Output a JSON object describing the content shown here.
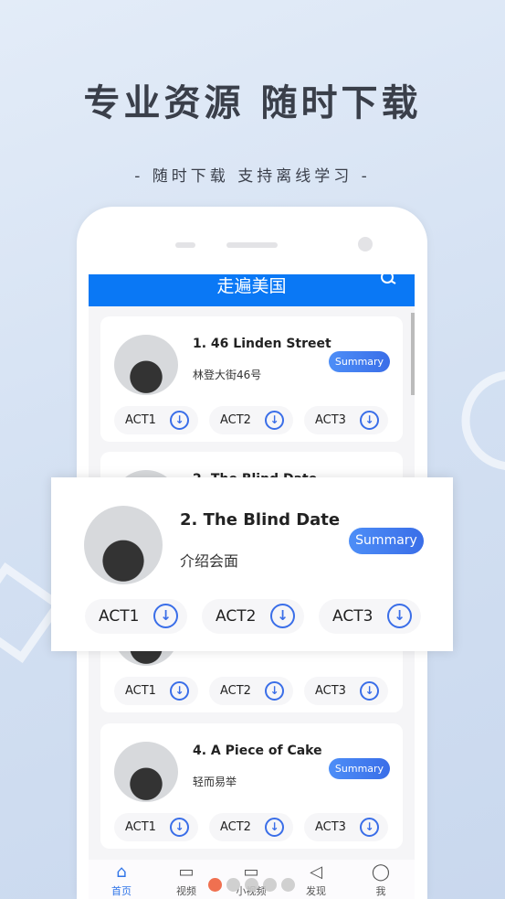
{
  "promo": {
    "headline": "专业资源 随时下载",
    "subline": "- 随时下载 支持离线学习 -"
  },
  "app": {
    "title": "走遍美国",
    "search_icon": "search-icon"
  },
  "colors": {
    "topbar": "#0a78f5",
    "accent": "#3a6ee8",
    "pager_active": "#f07050"
  },
  "cards": [
    {
      "title": "1. 46 Linden Street",
      "subtitle": "林登大街46号",
      "summary": "Summary",
      "acts": [
        "ACT1",
        "ACT2",
        "ACT3"
      ]
    },
    {
      "title": "2. The Blind Date",
      "subtitle": "介绍会面",
      "summary": "Summary",
      "acts": [
        "ACT1",
        "ACT2",
        "ACT3"
      ]
    },
    {
      "title": "",
      "subtitle": "",
      "summary": "",
      "acts": [
        "ACT1",
        "ACT2",
        "ACT3"
      ]
    },
    {
      "title": "4. A Piece of Cake",
      "subtitle": "轻而易举",
      "summary": "Summary",
      "acts": [
        "ACT1",
        "ACT2",
        "ACT3"
      ]
    }
  ],
  "popup": {
    "title": "2. The Blind Date",
    "subtitle": "介绍会面",
    "summary": "Summary",
    "acts": [
      "ACT1",
      "ACT2",
      "ACT3"
    ]
  },
  "tabs": [
    {
      "label": "首页",
      "icon": "home-icon",
      "active": true
    },
    {
      "label": "视频",
      "icon": "video-icon"
    },
    {
      "label": "小视频",
      "icon": "monitor-icon"
    },
    {
      "label": "发现",
      "icon": "compass-icon"
    },
    {
      "label": "我",
      "icon": "user-icon"
    }
  ],
  "pager": {
    "count": 5,
    "active": 1
  }
}
